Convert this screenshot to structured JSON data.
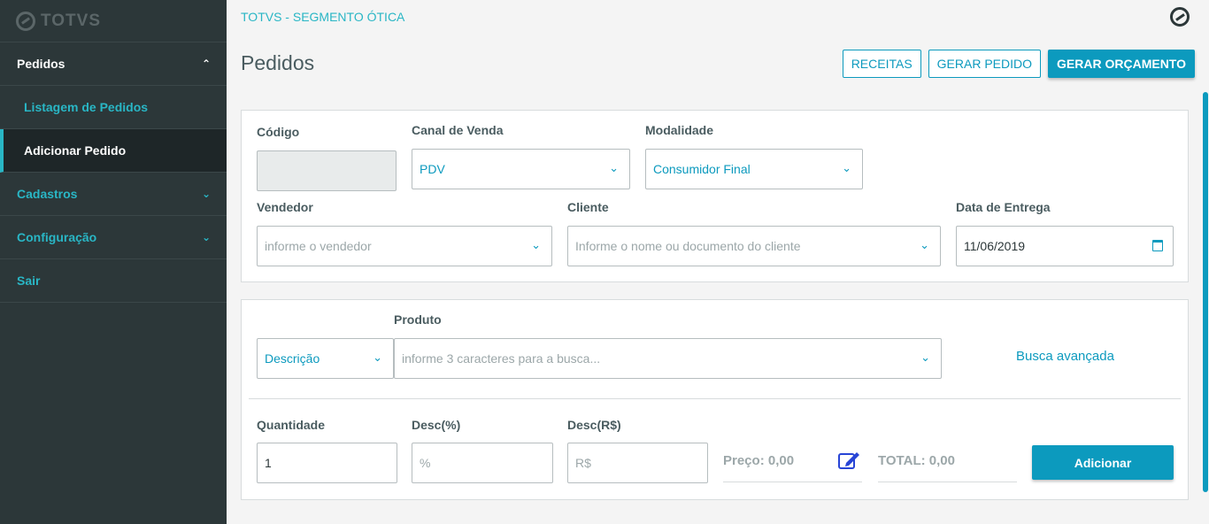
{
  "logo": {
    "text": "TOTVS"
  },
  "sidebar": {
    "items": [
      {
        "label": "Pedidos"
      },
      {
        "label": "Listagem de Pedidos"
      },
      {
        "label": "Adicionar Pedido"
      },
      {
        "label": "Cadastros"
      },
      {
        "label": "Configuração"
      },
      {
        "label": "Sair"
      }
    ]
  },
  "header": {
    "breadcrumb": "TOTVS - SEGMENTO ÓTICA",
    "title": "Pedidos",
    "buttons": {
      "receitas": "RECEITAS",
      "gerar_pedido": "GERAR PEDIDO",
      "gerar_orcamento": "GERAR ORÇAMENTO"
    }
  },
  "form": {
    "codigo": {
      "label": "Código",
      "value": ""
    },
    "canal": {
      "label": "Canal de Venda",
      "value": "PDV"
    },
    "modalidade": {
      "label": "Modalidade",
      "value": "Consumidor Final"
    },
    "vendedor": {
      "label": "Vendedor",
      "placeholder": "informe o vendedor"
    },
    "cliente": {
      "label": "Cliente",
      "placeholder": "Informe o nome ou documento do cliente"
    },
    "entrega": {
      "label": "Data de Entrega",
      "value": "11/06/2019"
    }
  },
  "produto": {
    "label": "Produto",
    "tipo": "Descrição",
    "placeholder": "informe 3 caracteres para a busca...",
    "busca_avancada": "Busca avançada"
  },
  "item": {
    "quantidade": {
      "label": "Quantidade",
      "value": "1"
    },
    "desc_pct": {
      "label": "Desc(%)",
      "placeholder": "%"
    },
    "desc_val": {
      "label": "Desc(R$)",
      "placeholder": "R$"
    },
    "preco": "Preço: 0,00",
    "total": "TOTAL: 0,00",
    "adicionar": "Adicionar"
  }
}
